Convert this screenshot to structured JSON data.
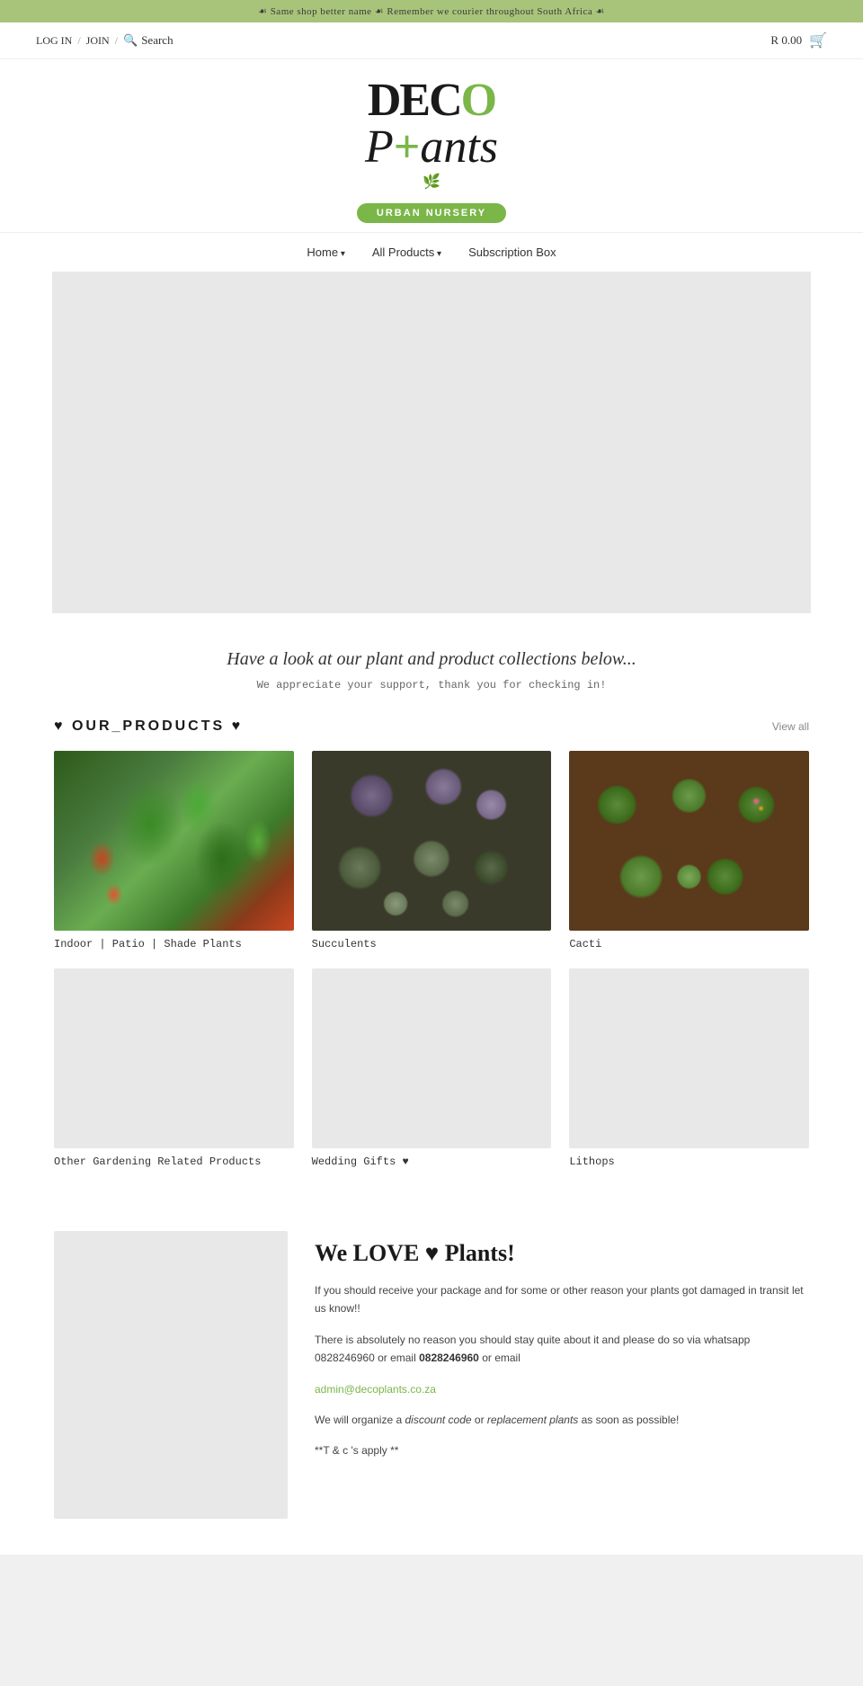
{
  "banner": {
    "text": "☙ Same shop better name ☙ Remember we courier throughout South Africa ☙"
  },
  "header": {
    "login": "LOG IN",
    "join": "JOIN",
    "search_label": "Search",
    "cart_price": "R 0.00"
  },
  "logo": {
    "line1": "DEC",
    "line1_o": "O",
    "line2_prefix": "P",
    "line2_cross": "+",
    "line2_suffix": "ants",
    "badge": "URBAN NURSERY",
    "leaf_symbol": "🌿"
  },
  "nav": {
    "items": [
      {
        "label": "Home",
        "has_dropdown": true
      },
      {
        "label": "All Products",
        "has_dropdown": true
      },
      {
        "label": "Subscription Box",
        "has_dropdown": false
      }
    ]
  },
  "intro": {
    "heading": "Have a look at our plant and product collections below...",
    "subtext": "We appreciate your support, thank you for checking in!"
  },
  "products_section": {
    "title": "♥ OUR_PRODUCTS ♥",
    "view_all": "View all",
    "items": [
      {
        "label": "Indoor | Patio | Shade Plants",
        "img_type": "indoor"
      },
      {
        "label": "Succulents",
        "img_type": "succulents"
      },
      {
        "label": "Cacti",
        "img_type": "cacti"
      },
      {
        "label": "Other Gardening Related Products",
        "img_type": "placeholder"
      },
      {
        "label": "Wedding Gifts ♥",
        "img_type": "placeholder"
      },
      {
        "label": "Lithops",
        "img_type": "placeholder"
      }
    ]
  },
  "about": {
    "heading": "We LOVE ♥ Plants!",
    "paragraph1": "If you should receive your package and for some or other reason your plants got damaged in transit let us know!!",
    "paragraph2": "There is absolutely no reason you should stay quite about it and please do so via whatsapp 0828246960 or email",
    "email": "admin@decoplants.co.za",
    "paragraph3_pre": "We will organize a ",
    "paragraph3_italic1": "discount code",
    "paragraph3_mid": " or ",
    "paragraph3_italic2": "replacement plants",
    "paragraph3_post": " as soon as possible!",
    "paragraph4": "**T & c 's apply **"
  }
}
